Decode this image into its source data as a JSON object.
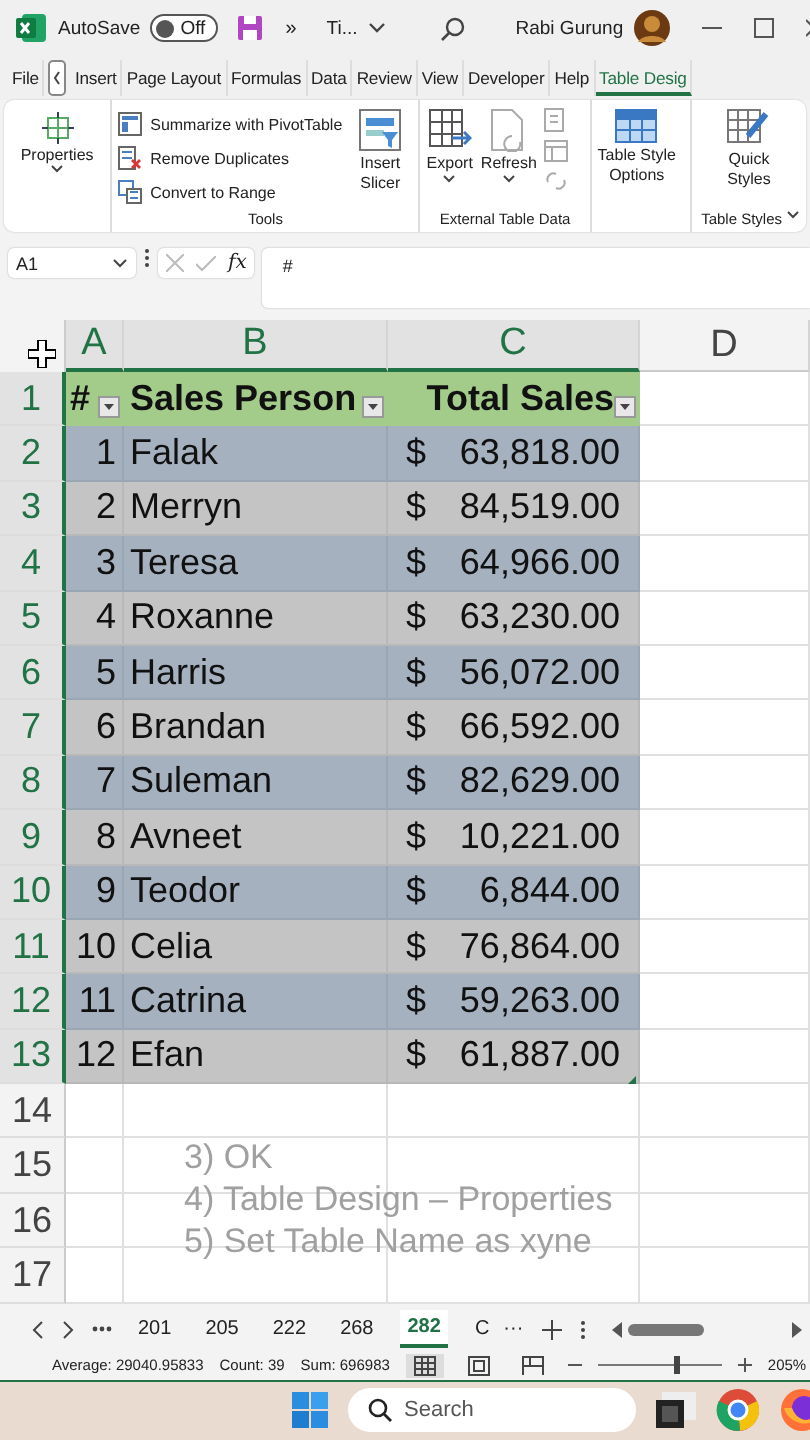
{
  "title_bar": {
    "autosave_label": "AutoSave",
    "autosave_toggle": {
      "label": "Off",
      "on": false
    },
    "more": "»",
    "file_name": "Ti...",
    "user_name": "Rabi Gurung"
  },
  "menu_tabs": [
    {
      "label": "File",
      "selected": false
    },
    {
      "label": "Insert",
      "selected": false
    },
    {
      "label": "Page Layout",
      "selected": false
    },
    {
      "label": "Formulas",
      "selected": false
    },
    {
      "label": "Data",
      "selected": false
    },
    {
      "label": "Review",
      "selected": false
    },
    {
      "label": "View",
      "selected": false
    },
    {
      "label": "Developer",
      "selected": false
    },
    {
      "label": "Help",
      "selected": false
    },
    {
      "label": "Table Desig",
      "selected": true
    }
  ],
  "ribbon": {
    "properties": "Properties",
    "tools": [
      "Summarize with PivotTable",
      "Remove Duplicates",
      "Convert to Range"
    ],
    "tools_label": "Tools",
    "slicer": [
      "Insert",
      "Slicer"
    ],
    "export": "Export",
    "refresh": "Refresh",
    "external_label": "External Table Data",
    "style_options": [
      "Table Style",
      "Options"
    ],
    "quick_styles": [
      "Quick",
      "Styles"
    ],
    "styles_label": "Table Styles"
  },
  "formula_bar": {
    "name_box": "A1",
    "fx_label": "fx",
    "formula": "#"
  },
  "columns": [
    {
      "label": "A",
      "selected": true
    },
    {
      "label": "B",
      "selected": true
    },
    {
      "label": "C",
      "selected": true
    },
    {
      "label": "D",
      "selected": false
    }
  ],
  "row_numbers": [
    {
      "label": "1",
      "selected": true
    },
    {
      "label": "2",
      "selected": true
    },
    {
      "label": "3",
      "selected": true
    },
    {
      "label": "4",
      "selected": true
    },
    {
      "label": "5",
      "selected": true
    },
    {
      "label": "6",
      "selected": true
    },
    {
      "label": "7",
      "selected": true
    },
    {
      "label": "8",
      "selected": true
    },
    {
      "label": "9",
      "selected": true
    },
    {
      "label": "10",
      "selected": true
    },
    {
      "label": "11",
      "selected": true
    },
    {
      "label": "12",
      "selected": true
    },
    {
      "label": "13",
      "selected": true
    },
    {
      "label": "14",
      "selected": false
    },
    {
      "label": "15",
      "selected": false
    },
    {
      "label": "16",
      "selected": false
    },
    {
      "label": "17",
      "selected": false
    }
  ],
  "table": {
    "headers": [
      "#",
      "Sales Person",
      "Total Sales"
    ],
    "rows": [
      {
        "num": "1",
        "name": "Falak",
        "currency": "$",
        "amount": "63,818.00"
      },
      {
        "num": "2",
        "name": "Merryn",
        "currency": "$",
        "amount": "84,519.00"
      },
      {
        "num": "3",
        "name": "Teresa",
        "currency": "$",
        "amount": "64,966.00"
      },
      {
        "num": "4",
        "name": "Roxanne",
        "currency": "$",
        "amount": "63,230.00"
      },
      {
        "num": "5",
        "name": "Harris",
        "currency": "$",
        "amount": "56,072.00"
      },
      {
        "num": "6",
        "name": "Brandan",
        "currency": "$",
        "amount": "66,592.00"
      },
      {
        "num": "7",
        "name": "Suleman",
        "currency": "$",
        "amount": "82,629.00"
      },
      {
        "num": "8",
        "name": "Avneet",
        "currency": "$",
        "amount": "10,221.00"
      },
      {
        "num": "9",
        "name": "Teodor",
        "currency": "$",
        "amount": "6,844.00"
      },
      {
        "num": "10",
        "name": "Celia",
        "currency": "$",
        "amount": "76,864.00"
      },
      {
        "num": "11",
        "name": "Catrina",
        "currency": "$",
        "amount": "59,263.00"
      },
      {
        "num": "12",
        "name": "Efan",
        "currency": "$",
        "amount": "61,887.00"
      }
    ]
  },
  "overlay_notes": [
    "3) OK",
    "4) Table Design – Properties",
    "5) Set Table Name as xyne"
  ],
  "sheet_tabs": [
    {
      "label": "201",
      "selected": false
    },
    {
      "label": "205",
      "selected": false
    },
    {
      "label": "222",
      "selected": false
    },
    {
      "label": "268",
      "selected": false
    },
    {
      "label": "282",
      "selected": true
    },
    {
      "label": "C",
      "selected": false
    }
  ],
  "sheet_more": "···",
  "status_bar": {
    "average": "Average: 29040.95833",
    "count": "Count: 39",
    "sum": "Sum: 696983",
    "zoom": "205%",
    "zoom_slider": {
      "level": 0.63
    }
  },
  "taskbar": {
    "search_placeholder": "Search"
  }
}
